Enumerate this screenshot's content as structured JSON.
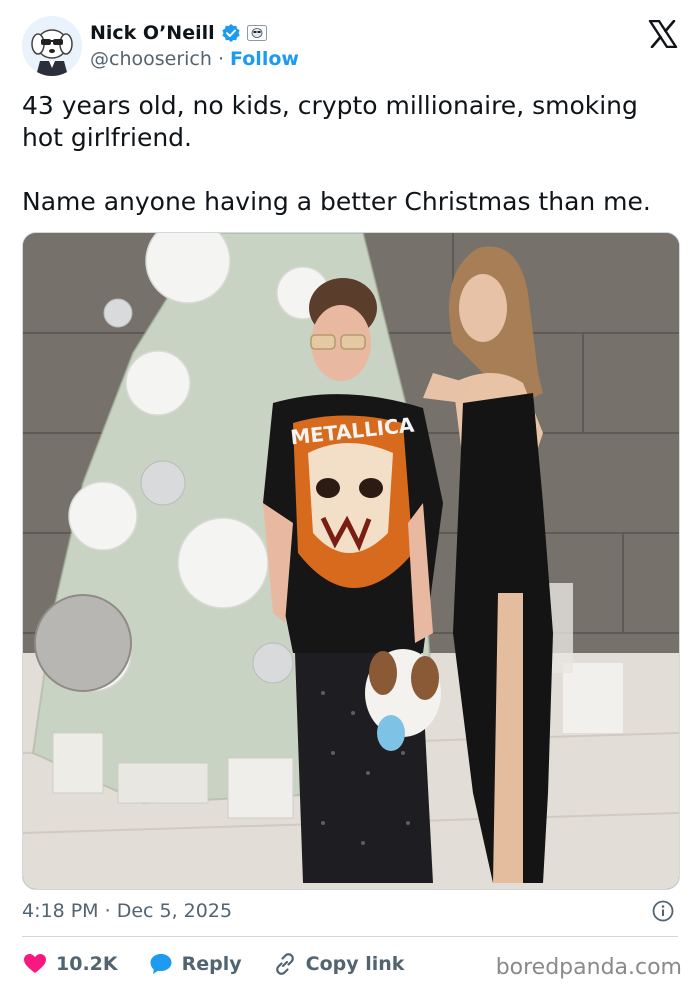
{
  "author": {
    "name": "Nick O’Neill",
    "handle": "@chooserich",
    "separator": "·",
    "follow_label": "Follow"
  },
  "tweet": {
    "text": "43 years old, no kids, crypto millionaire, smoking hot girlfriend.\n\nName anyone having a better Christmas than me."
  },
  "meta": {
    "time": "4:18 PM",
    "separator": "·",
    "date": "Dec 5, 2025"
  },
  "actions": {
    "like_count": "10.2K",
    "reply_label": "Reply",
    "copy_label": "Copy link"
  },
  "photo": {
    "shirt_text": "METALLICA"
  },
  "watermark": "boredpanda.com",
  "colors": {
    "accent": "#1d9bf0",
    "like": "#f91880",
    "muted": "#536471",
    "text": "#0f1419"
  },
  "icons": [
    "verified-badge-icon",
    "affiliate-badge-icon",
    "x-logo-icon",
    "info-icon",
    "heart-icon",
    "reply-bubble-icon",
    "link-icon"
  ]
}
